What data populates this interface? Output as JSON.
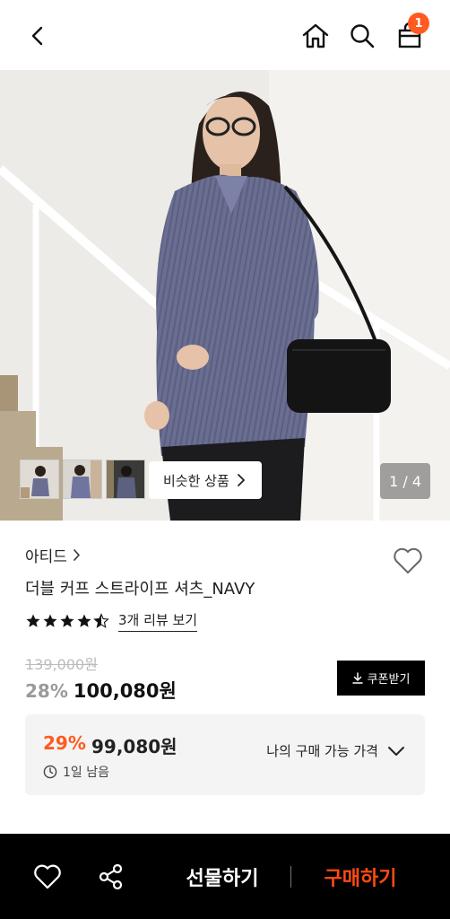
{
  "header": {
    "cart_count": "1"
  },
  "gallery": {
    "similar_label": "비슷한 상품",
    "page_indicator": "1 / 4"
  },
  "product": {
    "brand": "아티드",
    "name": "더블 커프 스트라이프 셔츠_NAVY",
    "rating": 4.5,
    "review_label": "3개 리뷰 보기",
    "original_price": "139,000원",
    "discount": "28%",
    "price": "100,080원",
    "coupon_label": "쿠폰받기"
  },
  "my_price": {
    "discount": "29%",
    "price": "99,080원",
    "time_left": "1일 남음",
    "toggle_label": "나의 구매 가능 가격"
  },
  "bottom_bar": {
    "gift_label": "선물하기",
    "buy_label": "구매하기"
  },
  "colors": {
    "accent": "#ff5a1f",
    "buy_text": "#ff4b12",
    "bottom_bar_bg": "#000000"
  }
}
